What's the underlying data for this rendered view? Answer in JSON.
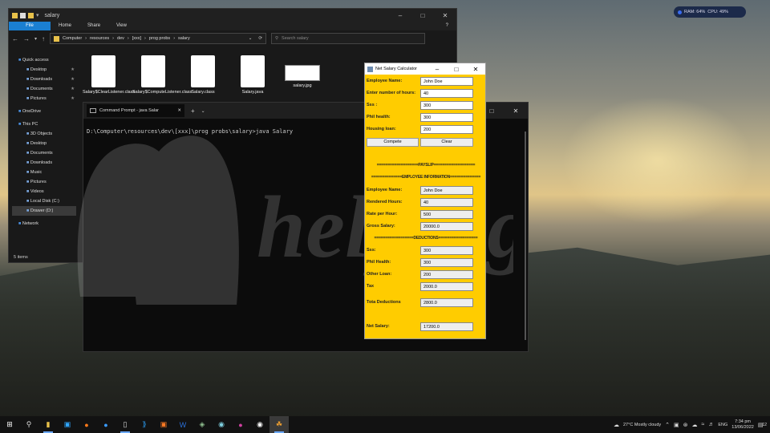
{
  "system_monitor": {
    "ram": "RAM: 64%",
    "cpu": "CPU: 49%"
  },
  "explorer": {
    "title": "salary",
    "ribbon": [
      "File",
      "Home",
      "Share",
      "View"
    ],
    "path": [
      "Computer",
      "resources",
      "dev",
      "[xxx]",
      "prog probs",
      "salary"
    ],
    "search_placeholder": "Search salary",
    "sidebar": [
      {
        "label": "Quick access",
        "level": 0,
        "pinned": false
      },
      {
        "label": "Desktop",
        "level": 1,
        "pinned": true
      },
      {
        "label": "Downloads",
        "level": 1,
        "pinned": true
      },
      {
        "label": "Documents",
        "level": 1,
        "pinned": true
      },
      {
        "label": "Pictures",
        "level": 1,
        "pinned": true
      },
      {
        "label": "OneDrive",
        "level": 0,
        "pinned": false
      },
      {
        "label": "This PC",
        "level": 0,
        "pinned": false
      },
      {
        "label": "3D Objects",
        "level": 1,
        "pinned": false
      },
      {
        "label": "Desktop",
        "level": 1,
        "pinned": false
      },
      {
        "label": "Documents",
        "level": 1,
        "pinned": false
      },
      {
        "label": "Downloads",
        "level": 1,
        "pinned": false
      },
      {
        "label": "Music",
        "level": 1,
        "pinned": false
      },
      {
        "label": "Pictures",
        "level": 1,
        "pinned": false
      },
      {
        "label": "Videos",
        "level": 1,
        "pinned": false
      },
      {
        "label": "Local Disk (C:)",
        "level": 1,
        "pinned": false
      },
      {
        "label": "Drawer (D:)",
        "level": 1,
        "pinned": false,
        "selected": true
      },
      {
        "label": "Network",
        "level": 0,
        "pinned": false
      }
    ],
    "files": [
      {
        "name": "Salary$ClearListener.class",
        "kind": "doc"
      },
      {
        "name": "Salary$ComputeListener.class",
        "kind": "doc"
      },
      {
        "name": "Salary.class",
        "kind": "doc"
      },
      {
        "name": "Salary.java",
        "kind": "doc"
      },
      {
        "name": "salary.jpg",
        "kind": "img"
      }
    ],
    "status": "5 items"
  },
  "cmd": {
    "tab_title": "Command Prompt - java  Salar",
    "prompt": "D:\\Computer\\resources\\dev\\[xxx]\\prog probs\\salary>java Salary"
  },
  "watermark": "helpinghand",
  "calculator": {
    "title": "Net Salary Calculator",
    "inputs": [
      {
        "label": "Employee Name:",
        "value": "John Doe"
      },
      {
        "label": "Enter number of hours:",
        "value": "40"
      },
      {
        "label": "Sss :",
        "value": "300"
      },
      {
        "label": "Phil health:",
        "value": "300"
      },
      {
        "label": "Housing loan:",
        "value": "200"
      }
    ],
    "compute_label": "Compete",
    "clear_label": "Clear",
    "payslip_header": "===================PAYSLIP===================",
    "info_header": "==============EMPLOYEE INFORMATION==============",
    "info": [
      {
        "label": "Employee Name:",
        "value": "John Doe"
      },
      {
        "label": "Rendered Hours:",
        "value": "40"
      },
      {
        "label": "Rate per Hour:",
        "value": "500"
      },
      {
        "label": "Gross Salary:",
        "value": "20000.0"
      }
    ],
    "deductions_header": "==================DEDUCTIONS==================",
    "deductions": [
      {
        "label": "Sss:",
        "value": "300"
      },
      {
        "label": "Phil Health:",
        "value": "300"
      },
      {
        "label": "Other Loan:",
        "value": "200"
      },
      {
        "label": "Tax",
        "value": "2000.0"
      }
    ],
    "total_label": "Tota Deductions",
    "total_value": "2800.0",
    "net_label": "Net Salary:",
    "net_value": "17200.0"
  },
  "taskbar": {
    "weather": "27°C  Mostly cloudy",
    "lang": "ENG",
    "time": "7:34 pm",
    "date": "13/06/2022",
    "notifications": "12"
  }
}
